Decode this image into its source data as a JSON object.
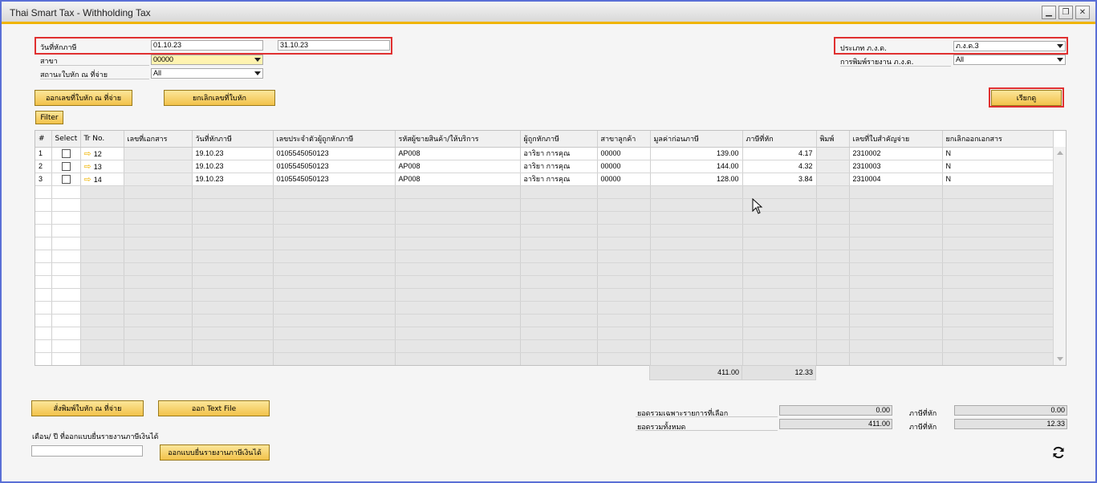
{
  "window": {
    "title": "Thai Smart Tax - Withholding Tax"
  },
  "filters": {
    "date_label": "วันที่หักภาษี",
    "date_from": "01.10.23",
    "date_to": "31.10.23",
    "branch_label": "สาขา",
    "branch_value": "00000",
    "place_label": "สถานะใบหัก ณ ที่จ่าย",
    "place_value": "All",
    "pnd_type_label": "ประเภท ภ.ง.ด.",
    "pnd_type_value": "ภ.ง.ด.3",
    "print_type_label": "การพิมพ์รายงาน ภ.ง.ด.",
    "print_type_value": "All"
  },
  "buttons": {
    "issue_number": "ออกเลขที่ใบหัก ณ ที่จ่าย",
    "cancel_number": "ยกเลิกเลขที่ใบหัก",
    "filter": "Filter",
    "fetch": "เรียกดู",
    "print": "สั่งพิมพ์ใบหัก ณ ที่จ่าย",
    "text_file": "ออก Text File",
    "issue_form": "ออกแบบยื่นรายงานภาษีเงินได้"
  },
  "table": {
    "columns": [
      "#",
      "Select",
      "Tr No.",
      "เลขที่เอกสาร",
      "วันที่หักภาษี",
      "เลขประจำตัวผู้ถูกหักภาษี",
      "รหัสผู้ขายสินค้า/ให้บริการ",
      "ผู้ถูกหักภาษี",
      "สาขาลูกค้า",
      "มูลค่าก่อนภาษี",
      "ภาษีที่หัก",
      "พิมพ์",
      "เลขที่ใบสำคัญจ่าย",
      "ยกเลิกออกเอกสาร"
    ],
    "rows": [
      {
        "n": "1",
        "tr": "12",
        "doc": "",
        "date": "19.10.23",
        "taxid": "0105545050123",
        "vendor": "AP008",
        "name": "อาริยา การคุณ",
        "branch": "00000",
        "amount": "139.00",
        "tax": "4.17",
        "printed": "",
        "voucher": "2310002",
        "cancel": "N"
      },
      {
        "n": "2",
        "tr": "13",
        "doc": "",
        "date": "19.10.23",
        "taxid": "0105545050123",
        "vendor": "AP008",
        "name": "อาริยา การคุณ",
        "branch": "00000",
        "amount": "144.00",
        "tax": "4.32",
        "printed": "",
        "voucher": "2310003",
        "cancel": "N"
      },
      {
        "n": "3",
        "tr": "14",
        "doc": "",
        "date": "19.10.23",
        "taxid": "0105545050123",
        "vendor": "AP008",
        "name": "อาริยา การคุณ",
        "branch": "00000",
        "amount": "128.00",
        "tax": "3.84",
        "printed": "",
        "voucher": "2310004",
        "cancel": "N"
      }
    ],
    "total_amount": "411.00",
    "total_tax": "12.33"
  },
  "summary": {
    "selected_label": "ยอดรวมเฉพาะรายการที่เลือก",
    "selected_value": "0.00",
    "selected_tax_label": "ภาษีที่หัก",
    "selected_tax_value": "0.00",
    "all_label": "ยอดรวมทั้งหมด",
    "all_value": "411.00",
    "all_tax_label": "ภาษีที่หัก",
    "all_tax_value": "12.33"
  },
  "period": {
    "label": "เดือน/ ปี ที่ออกแบบยื่นรายงานภาษีเงินได้",
    "value": ""
  }
}
